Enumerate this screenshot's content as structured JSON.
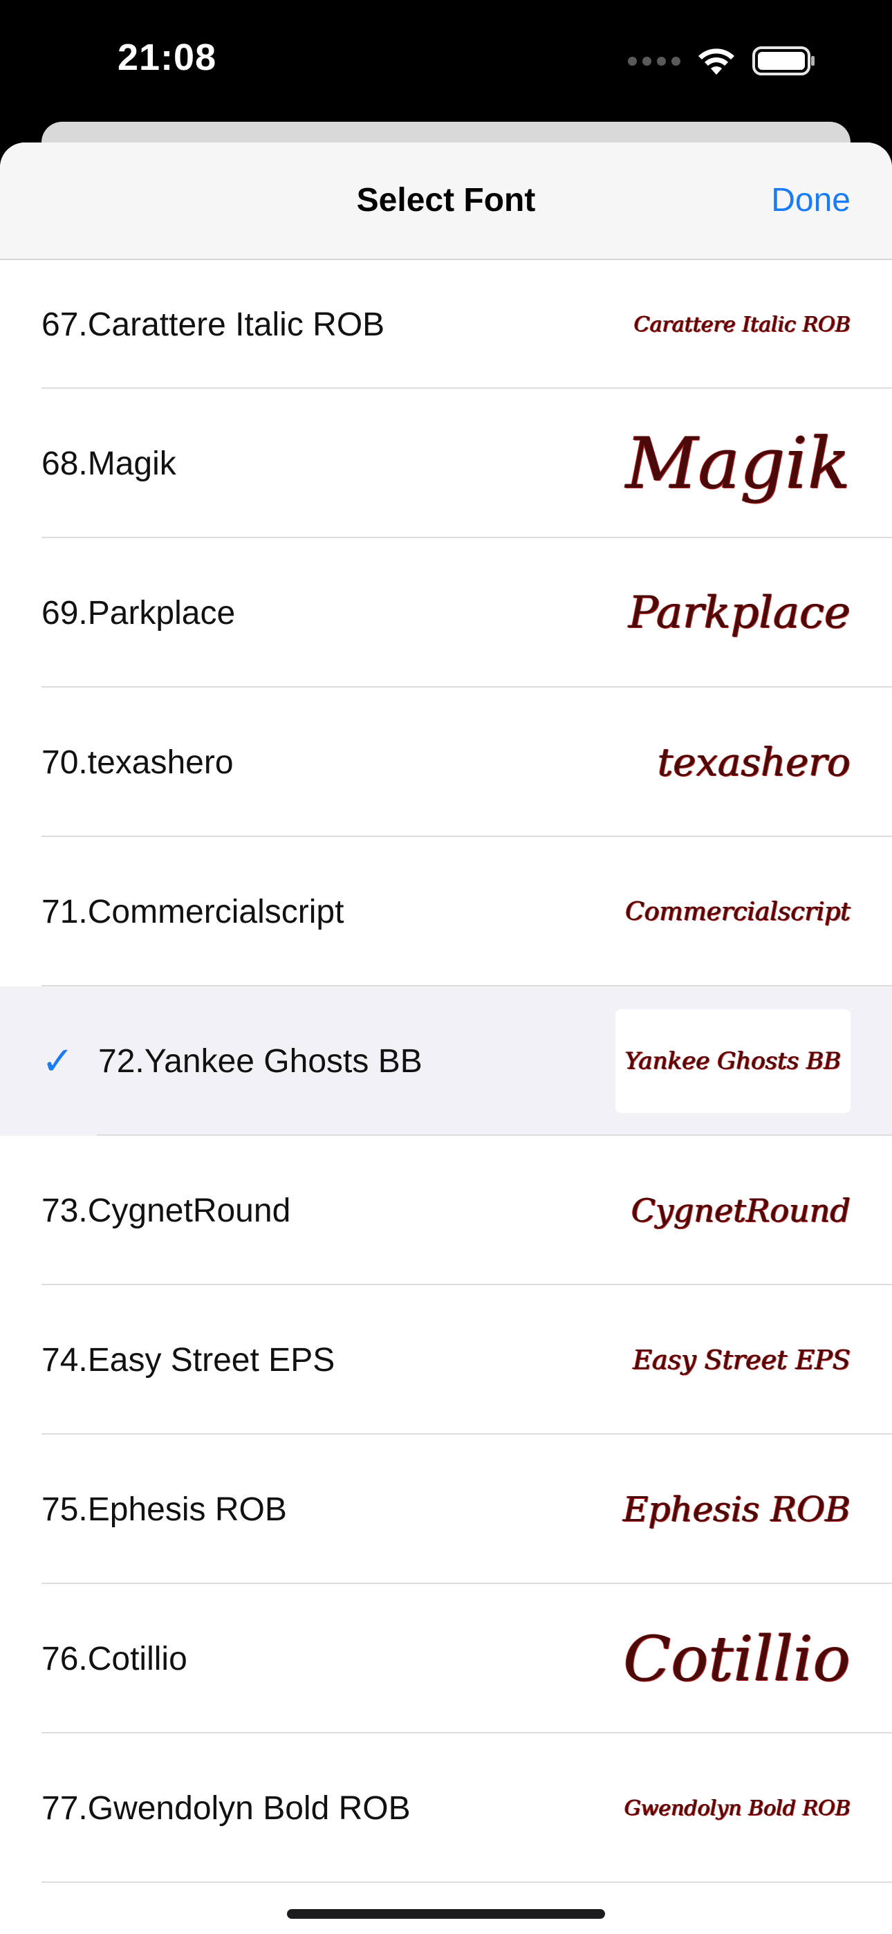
{
  "status": {
    "time": "21:08"
  },
  "sheet": {
    "title": "Select Font",
    "done_label": "Done"
  },
  "fonts": [
    {
      "label": "67.Carattere Italic ROB",
      "preview": "Carattere Italic ROB",
      "size": 38,
      "selected": false
    },
    {
      "label": "68.Magik",
      "preview": "Magik",
      "size": 110,
      "selected": false
    },
    {
      "label": "69.Parkplace",
      "preview": "Parkplace",
      "size": 66,
      "selected": false
    },
    {
      "label": "70.texashero",
      "preview": "texashero",
      "size": 56,
      "selected": false
    },
    {
      "label": "71.Commercialscript",
      "preview": "Commercialscript",
      "size": 46,
      "selected": false
    },
    {
      "label": "72.Yankee Ghosts BB",
      "preview": "Yankee Ghosts BB",
      "size": 40,
      "selected": true
    },
    {
      "label": "73.CygnetRound",
      "preview": "CygnetRound",
      "size": 50,
      "selected": false
    },
    {
      "label": "74.Easy Street EPS",
      "preview": "Easy Street EPS",
      "size": 42,
      "selected": false
    },
    {
      "label": "75.Ephesis ROB",
      "preview": "Ephesis ROB",
      "size": 52,
      "selected": false
    },
    {
      "label": "76.Cotillio",
      "preview": "Cotillio",
      "size": 106,
      "selected": false
    },
    {
      "label": "77.Gwendolyn Bold ROB",
      "preview": "Gwendolyn Bold ROB",
      "size": 36,
      "selected": false
    }
  ],
  "colors": {
    "accent": "#1a7cf5",
    "selected_row": "#f1f1f6"
  }
}
